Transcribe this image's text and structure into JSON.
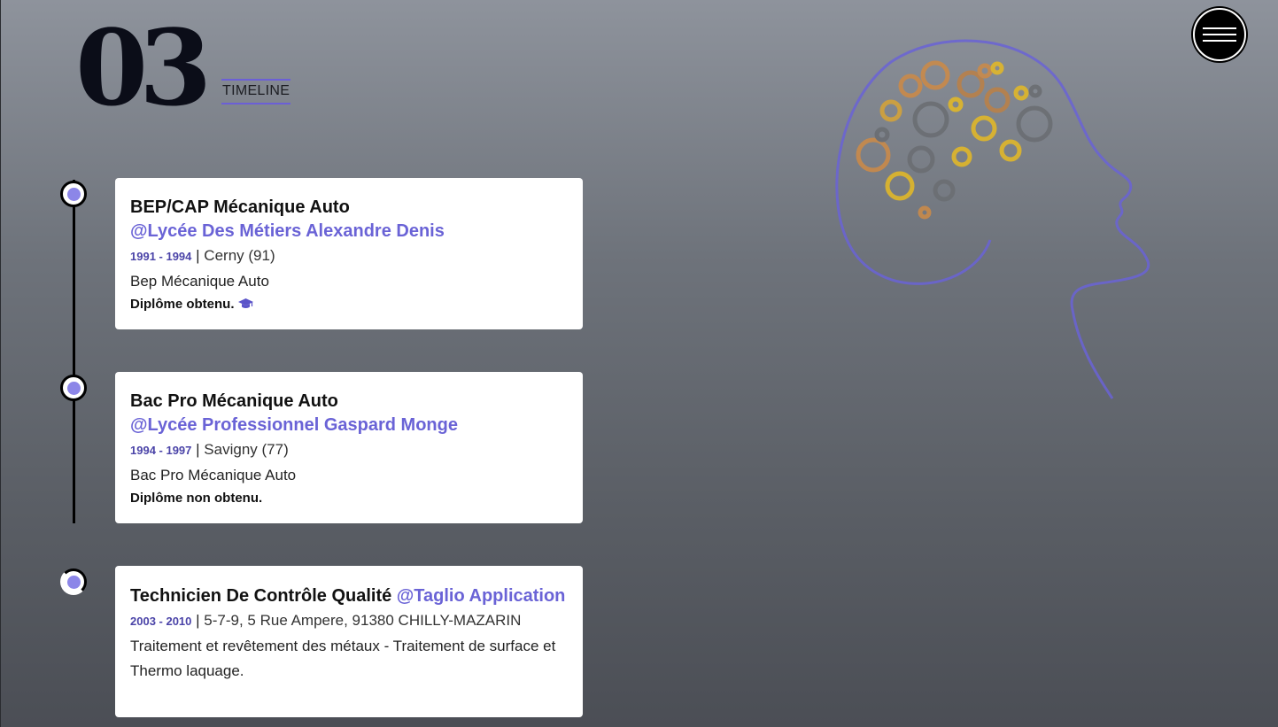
{
  "section": {
    "number": "03",
    "label": "TIMELINE"
  },
  "colors": {
    "accent": "#6a63d6",
    "node_fill": "#8c86e8",
    "line": "#000000"
  },
  "timeline": [
    {
      "title": "BEP/CAP Mécanique Auto",
      "org": "@Lycée Des Métiers Alexandre Denis",
      "dates": "1991 - 1994",
      "separator": "|",
      "location": "Cerny (91)",
      "description": "Bep Mécanique Auto",
      "status": "Diplôme obtenu.",
      "icon": "graduation-cap-icon"
    },
    {
      "title": "Bac Pro Mécanique Auto",
      "org": "@Lycée Professionnel Gaspard Monge",
      "dates": "1994 - 1997",
      "separator": "|",
      "location": "Savigny (77)",
      "description": "Bac Pro Mécanique Auto",
      "status": "Diplôme non obtenu."
    },
    {
      "title": "Technicien De Contrôle Qualité",
      "org": "@Taglio Application",
      "dates": "2003 - 2010",
      "separator": "|",
      "location": "5-7-9, 5 Rue Ampere, 91380 CHILLY-MAZARIN",
      "description": "Traitement et revêtement des métaux - Traitement de surface et Thermo laquage."
    }
  ],
  "menu": {
    "icon": "hamburger-menu-icon"
  },
  "illustration": {
    "icon": "brain-gears-head-icon"
  }
}
